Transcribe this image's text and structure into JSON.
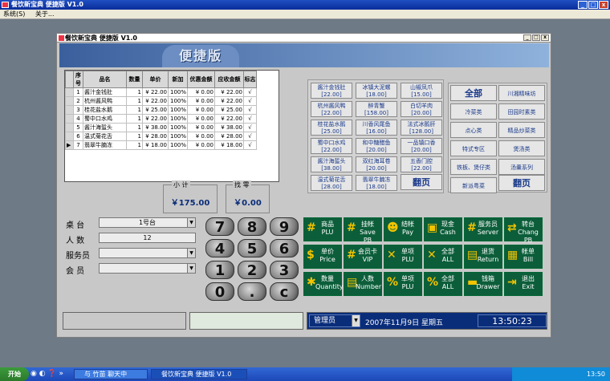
{
  "outer_window": {
    "title": "餐饮新宝典 便捷版 V1.0"
  },
  "menubar": {
    "items": [
      "系统(S)",
      "关于..."
    ]
  },
  "inner_window": {
    "title": "餐饮新宝典 便捷版 V1.0"
  },
  "banner": {
    "label": "便捷版"
  },
  "order_table": {
    "headers": [
      "序号",
      "品名",
      "数量",
      "单价",
      "新加",
      "优惠金额",
      "应收金额",
      "标志"
    ],
    "rows": [
      [
        "1",
        "酱汁金钱肚",
        "1",
        "¥ 22.00",
        "100%",
        "¥ 0.00",
        "¥ 22.00",
        "√"
      ],
      [
        "2",
        "杭州酱风鸭",
        "1",
        "¥ 22.00",
        "100%",
        "¥ 0.00",
        "¥ 22.00",
        "√"
      ],
      [
        "3",
        "桂花盐水鹅",
        "1",
        "¥ 25.00",
        "100%",
        "¥ 0.00",
        "¥ 25.00",
        "√"
      ],
      [
        "4",
        "蜀中口水鸡",
        "1",
        "¥ 22.00",
        "100%",
        "¥ 0.00",
        "¥ 22.00",
        "√"
      ],
      [
        "5",
        "酱汁海蜇头",
        "1",
        "¥ 38.00",
        "100%",
        "¥ 0.00",
        "¥ 38.00",
        "√"
      ],
      [
        "6",
        "温式菊花舌",
        "1",
        "¥ 28.00",
        "100%",
        "¥ 0.00",
        "¥ 28.00",
        "√"
      ],
      [
        "7",
        "翡翠牛腩冻",
        "1",
        "¥ 18.00",
        "100%",
        "¥ 0.00",
        "¥ 18.00",
        "√"
      ]
    ]
  },
  "totals": {
    "subtotal_label": "小 计",
    "subtotal_value": "￥175.00",
    "change_label": "找 零",
    "change_value": "￥0.00"
  },
  "dishes": [
    {
      "name": "酱汁金钱肚",
      "price": "[22.00]"
    },
    {
      "name": "冰镇大泥螺",
      "price": "[18.00]"
    },
    {
      "name": "山椒凤爪",
      "price": "[15.00]"
    },
    {
      "name": "杭州酱风鸭",
      "price": "[22.00]"
    },
    {
      "name": "醉青蟹",
      "price": "[158.00]"
    },
    {
      "name": "白切羊肉",
      "price": "[20.00]"
    },
    {
      "name": "桂花盐水鹅",
      "price": "[25.00]"
    },
    {
      "name": "川香风尾鱼",
      "price": "[16.00]"
    },
    {
      "name": "法式冰鹅肝",
      "price": "[128.00]"
    },
    {
      "name": "蜀中口水鸡",
      "price": "[22.00]"
    },
    {
      "name": "和中糖醋鱼",
      "price": "[20.00]"
    },
    {
      "name": "一品镇口香",
      "price": "[20.00]"
    },
    {
      "name": "酱汁海蜇头",
      "price": "[38.00]"
    },
    {
      "name": "双红海耳卷",
      "price": "[20.00]"
    },
    {
      "name": "五香门腔",
      "price": "[22.00]"
    },
    {
      "name": "温式菊花舌",
      "price": "[28.00]"
    },
    {
      "name": "翡翠牛腩冻",
      "price": "[18.00]"
    }
  ],
  "dish_page_label": "翻页",
  "categories": [
    "全部",
    "川湘精味坊",
    "冷菜类",
    "田园时素类",
    "点心类",
    "精品炒菜类",
    "特式专区",
    "煲汤类",
    "铁板、煲仔类",
    "汤羹系列",
    "新派粤菜"
  ],
  "category_page_label": "翻页",
  "form": {
    "table_label": "桌  台",
    "table_value": "1号台",
    "people_label": "人  数",
    "people_value": "12",
    "waiter_label": "服务员",
    "waiter_value": "",
    "member_label": "会  员",
    "member_value": ""
  },
  "keypad": [
    "7",
    "8",
    "9",
    "4",
    "5",
    "6",
    "1",
    "2",
    "3",
    "0",
    ".",
    "c"
  ],
  "function_buttons": [
    {
      "icon": "#",
      "cn": "商品",
      "en": "PLU"
    },
    {
      "icon": "#",
      "cn": "挂帐",
      "en": "Save PB"
    },
    {
      "icon": "☻",
      "cn": "结帐",
      "en": "Pay"
    },
    {
      "icon": "▣",
      "cn": "现金",
      "en": "Cash"
    },
    {
      "icon": "#",
      "cn": "服务员",
      "en": "Server"
    },
    {
      "icon": "⇄",
      "cn": "转台",
      "en": "Chang PB"
    },
    {
      "icon": "$",
      "cn": "单价",
      "en": "Price"
    },
    {
      "icon": "#",
      "cn": "会员卡",
      "en": "VIP"
    },
    {
      "icon": "✕",
      "cn": "单项",
      "en": "PLU"
    },
    {
      "icon": "✕",
      "cn": "全部",
      "en": "ALL"
    },
    {
      "icon": "▤",
      "cn": "退货",
      "en": "Return"
    },
    {
      "icon": "▦",
      "cn": "帐单",
      "en": "Bill"
    },
    {
      "icon": "✱",
      "cn": "数量",
      "en": "Quantity"
    },
    {
      "icon": "▤",
      "cn": "人数",
      "en": "Number"
    },
    {
      "icon": "%",
      "cn": "单项",
      "en": "PLU"
    },
    {
      "icon": "%",
      "cn": "全部",
      "en": "ALL"
    },
    {
      "icon": "▬",
      "cn": "钱箱",
      "en": "Drawer"
    },
    {
      "icon": "⇥",
      "cn": "退出",
      "en": "Exit"
    }
  ],
  "statusbar": {
    "operator": "管理员",
    "date": "2007年11月9日  星期五",
    "time": "13:50:23"
  },
  "taskbar": {
    "start_label": "开始",
    "items": [
      "与 竹苗 聊天中",
      "餐饮新宝典 便捷版 V1.0"
    ],
    "clock": "13:50"
  },
  "colors": {
    "fn_green": "#0c5e3a",
    "status_navy": "#0a2d7a",
    "dish_text": "#1a3a8a",
    "banner": "#6c8ec2"
  }
}
